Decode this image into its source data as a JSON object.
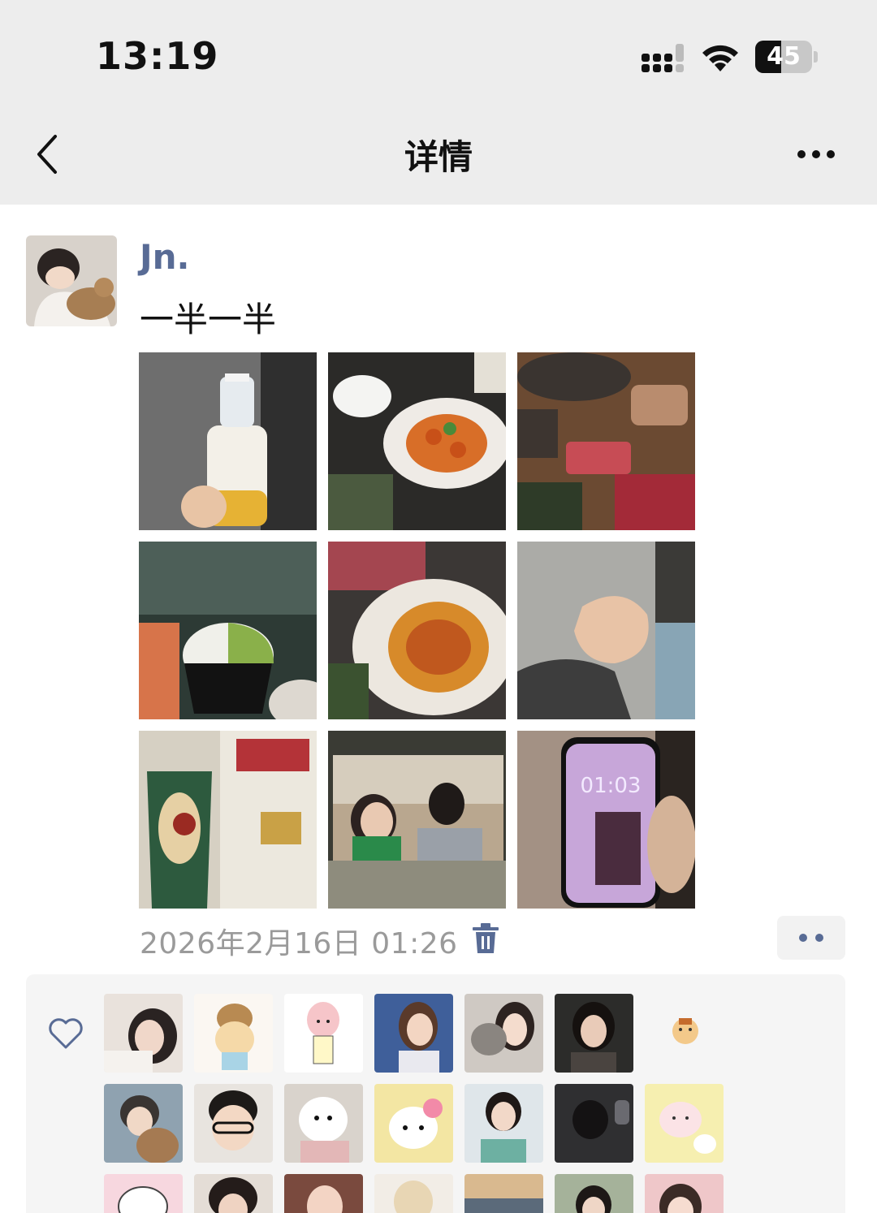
{
  "status_bar": {
    "time": "13:19",
    "battery_level": "45",
    "battery_fraction": 0.45
  },
  "nav": {
    "title": "详情",
    "back_icon": "chevron-left-icon",
    "more_icon": "more-horizontal-icon"
  },
  "post": {
    "username": "Jn.",
    "text": "一半一半",
    "timestamp": "2026年2月16日 01:26",
    "photo_count": 9
  },
  "likes": {
    "heart_icon": "heart-outline-icon"
  },
  "colors": {
    "link_blue": "#586b95",
    "timestamp_gray": "#9a9a9a",
    "background_gray": "#ededed"
  }
}
